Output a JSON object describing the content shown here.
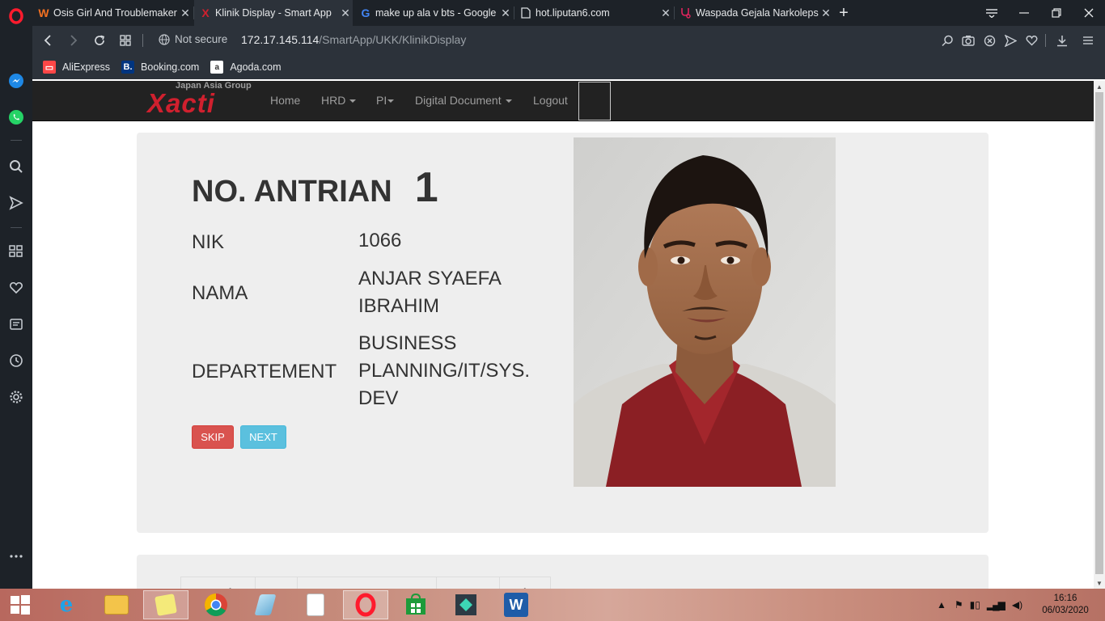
{
  "browser": {
    "tabs": [
      {
        "title": "Osis Girl And Troublemaker",
        "favicon": "W",
        "favicon_color": "#f37021",
        "active": false
      },
      {
        "title": "Klinik Display - Smart App",
        "favicon": "X",
        "favicon_color": "#d0202e",
        "active": true
      },
      {
        "title": "make up ala v bts - Google",
        "favicon": "G",
        "favicon_color": "#4285f4",
        "active": false
      },
      {
        "title": "hot.liputan6.com",
        "favicon": "page-icon",
        "active": false
      },
      {
        "title": "Waspada Gejala Narkolepsi",
        "favicon": "stethoscope-icon",
        "favicon_color": "#e0245e",
        "active": false
      }
    ],
    "security_label": "Not secure",
    "url_host": "172.17.145.114",
    "url_path": "/SmartApp/UKK/KlinikDisplay",
    "bookmarks": [
      {
        "label": "AliExpress",
        "icon": "aliexpress-icon",
        "color": "#ff4747"
      },
      {
        "label": "Booking.com",
        "icon": "booking-icon",
        "color": "#003580"
      },
      {
        "label": "Agoda.com",
        "icon": "agoda-icon",
        "color": "#ffffff"
      }
    ]
  },
  "site": {
    "brand_tag": "Japan Asia Group",
    "brand_logo": "Xacti",
    "brand_color": "#d0202e",
    "nav": {
      "home": "Home",
      "hrd": "HRD",
      "pi": "PI",
      "digital_document": "Digital Document",
      "logout": "Logout"
    }
  },
  "queue": {
    "title": "NO. ANTRIAN",
    "number": "1",
    "nik_label": "NIK",
    "nik_value": "1066",
    "nama_label": "NAMA",
    "nama_value": "ANJAR SYAEFA IBRAHIM",
    "dept_label": "DEPARTEMENT",
    "dept_value": "BUSINESS PLANNING/IT/SYS. DEV",
    "skip_label": "SKIP",
    "next_label": "NEXT"
  },
  "list_table": {
    "headers": [
      "No. Antrian",
      "NIK",
      "Nama",
      "Status",
      "Action"
    ]
  },
  "taskbar": {
    "apps": [
      "start-icon",
      "ie-icon",
      "explorer-icon",
      "sticky-notes-icon",
      "chrome-icon",
      "notepad-icon",
      "file-icon",
      "opera-icon",
      "store-icon",
      "filmora-icon",
      "word-icon"
    ],
    "time": "16:16",
    "date": "06/03/2020"
  }
}
